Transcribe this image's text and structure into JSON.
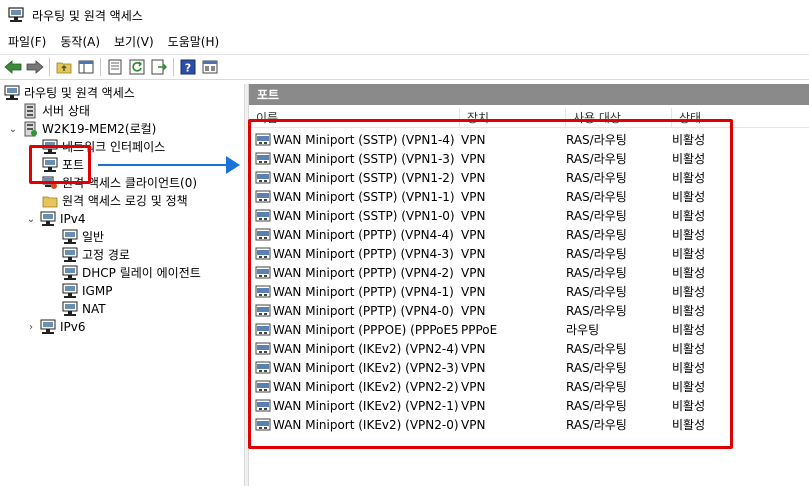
{
  "window": {
    "title": "라우팅 및 원격 액세스"
  },
  "menu": [
    "파일(F)",
    "동작(A)",
    "보기(V)",
    "도움말(H)"
  ],
  "toolbar": [
    {
      "name": "back-icon"
    },
    {
      "name": "forward-icon"
    },
    {
      "sep": true
    },
    {
      "name": "up-folder-icon"
    },
    {
      "name": "show-hide-tree-icon"
    },
    {
      "sep": true
    },
    {
      "name": "properties-icon"
    },
    {
      "name": "refresh-icon"
    },
    {
      "name": "export-list-icon"
    },
    {
      "sep": true
    },
    {
      "name": "help-icon"
    },
    {
      "name": "view-icon"
    }
  ],
  "tree": [
    {
      "label": "라우팅 및 원격 액세스",
      "icon": "server-icon",
      "level": 0,
      "chev": ""
    },
    {
      "label": "서버 상태",
      "icon": "server-status-icon",
      "level": 1,
      "chev": ""
    },
    {
      "label": "W2K19-MEM2(로컬)",
      "icon": "server-local-icon",
      "level": 0,
      "chev": "open"
    },
    {
      "label": "네트워크 인터페이스",
      "icon": "network-interface-icon",
      "level": 2,
      "chev": ""
    },
    {
      "label": "포트",
      "icon": "ports-icon",
      "level": 2,
      "chev": ""
    },
    {
      "label": "원격 액세스 클라이언트(0)",
      "icon": "remote-clients-icon",
      "level": 2,
      "chev": ""
    },
    {
      "label": "원격 액세스 로깅 및 정책",
      "icon": "folder-icon",
      "level": 2,
      "chev": ""
    },
    {
      "label": "IPv4",
      "icon": "ipv4-icon",
      "level": 1,
      "chev": "open"
    },
    {
      "label": "일반",
      "icon": "general-icon",
      "level": 3,
      "chev": ""
    },
    {
      "label": "고정 경로",
      "icon": "static-routes-icon",
      "level": 3,
      "chev": ""
    },
    {
      "label": "DHCP 릴레이 에이전트",
      "icon": "dhcp-relay-icon",
      "level": 3,
      "chev": ""
    },
    {
      "label": "IGMP",
      "icon": "igmp-icon",
      "level": 3,
      "chev": ""
    },
    {
      "label": "NAT",
      "icon": "nat-icon",
      "level": 3,
      "chev": ""
    },
    {
      "label": "IPv6",
      "icon": "ipv6-icon",
      "level": 1,
      "chev": "closed"
    }
  ],
  "pane": {
    "header": "포트",
    "columns": [
      "이름",
      "장치",
      "사용 대상",
      "상태"
    ],
    "rows": [
      [
        "WAN Miniport (SSTP) (VPN1-4)",
        "VPN",
        "RAS/라우팅",
        "비활성"
      ],
      [
        "WAN Miniport (SSTP) (VPN1-3)",
        "VPN",
        "RAS/라우팅",
        "비활성"
      ],
      [
        "WAN Miniport (SSTP) (VPN1-2)",
        "VPN",
        "RAS/라우팅",
        "비활성"
      ],
      [
        "WAN Miniport (SSTP) (VPN1-1)",
        "VPN",
        "RAS/라우팅",
        "비활성"
      ],
      [
        "WAN Miniport (SSTP) (VPN1-0)",
        "VPN",
        "RAS/라우팅",
        "비활성"
      ],
      [
        "WAN Miniport (PPTP) (VPN4-4)",
        "VPN",
        "RAS/라우팅",
        "비활성"
      ],
      [
        "WAN Miniport (PPTP) (VPN4-3)",
        "VPN",
        "RAS/라우팅",
        "비활성"
      ],
      [
        "WAN Miniport (PPTP) (VPN4-2)",
        "VPN",
        "RAS/라우팅",
        "비활성"
      ],
      [
        "WAN Miniport (PPTP) (VPN4-1)",
        "VPN",
        "RAS/라우팅",
        "비활성"
      ],
      [
        "WAN Miniport (PPTP) (VPN4-0)",
        "VPN",
        "RAS/라우팅",
        "비활성"
      ],
      [
        "WAN Miniport (PPPOE) (PPPoE5...",
        "PPPoE",
        "라우팅",
        "비활성"
      ],
      [
        "WAN Miniport (IKEv2) (VPN2-4)",
        "VPN",
        "RAS/라우팅",
        "비활성"
      ],
      [
        "WAN Miniport (IKEv2) (VPN2-3)",
        "VPN",
        "RAS/라우팅",
        "비활성"
      ],
      [
        "WAN Miniport (IKEv2) (VPN2-2)",
        "VPN",
        "RAS/라우팅",
        "비활성"
      ],
      [
        "WAN Miniport (IKEv2) (VPN2-1)",
        "VPN",
        "RAS/라우팅",
        "비활성"
      ],
      [
        "WAN Miniport (IKEv2) (VPN2-0)",
        "VPN",
        "RAS/라우팅",
        "비활성"
      ]
    ]
  },
  "colors": {
    "annotation": "#e00000",
    "arrow": "#1a73d9",
    "header_bg": "#8a8a8a"
  }
}
